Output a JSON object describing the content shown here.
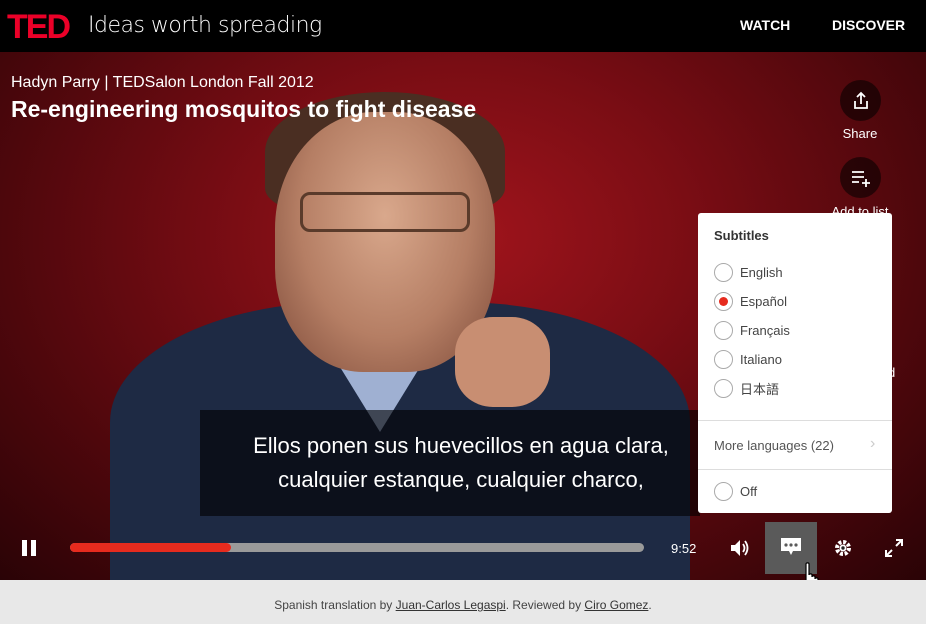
{
  "header": {
    "logo": "TED",
    "tagline": "Ideas worth spreading",
    "nav": [
      "WATCH",
      "DISCOVER"
    ]
  },
  "talk": {
    "meta": "Hadyn Parry | TEDSalon London Fall 2012",
    "title": "Re-engineering mosquitos to fight disease"
  },
  "side_actions": {
    "share_label": "Share",
    "add_label": "Add to list",
    "partial_label": "d"
  },
  "caption": {
    "line1": "Ellos ponen sus huevecillos en agua clara,",
    "line2": "cualquier estanque, cualquier charco,"
  },
  "player": {
    "time": "9:52",
    "progress": 0.28,
    "icons": [
      "pause-icon",
      "volume-icon",
      "subtitles-icon",
      "settings-icon",
      "fullscreen-icon"
    ]
  },
  "subtitles_menu": {
    "title": "Subtitles",
    "options": [
      {
        "label": "English",
        "selected": false
      },
      {
        "label": "Español",
        "selected": true
      },
      {
        "label": "Français",
        "selected": false
      },
      {
        "label": "Italiano",
        "selected": false
      },
      {
        "label": "日本語",
        "selected": false
      }
    ],
    "more": "More languages (22)",
    "off": "Off"
  },
  "footer": {
    "prefix": "Spanish translation by ",
    "translator": "Juan-Carlos Legaspi",
    "middle": ". Reviewed by ",
    "reviewer": "Ciro Gomez",
    "suffix": "."
  },
  "colors": {
    "accent": "#e62b1e",
    "brand": "#eb0028"
  }
}
